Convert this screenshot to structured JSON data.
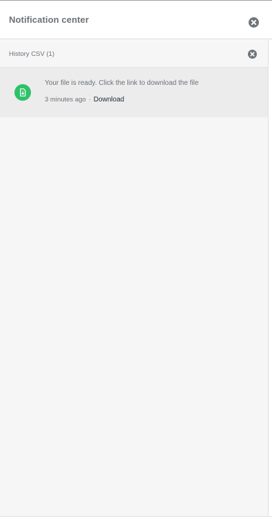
{
  "header": {
    "title": "Notification center"
  },
  "groups": [
    {
      "title": "History CSV (1)",
      "items": [
        {
          "icon": "file-download-icon",
          "message": "Your file is ready. Click the link to download the file",
          "time": "3 minutes ago",
          "separator": "·",
          "link_label": "Download"
        }
      ]
    }
  ],
  "colors": {
    "accent_green": "#2ec16a",
    "close_gray": "#6f757b",
    "panel_bg": "#f6f6f6",
    "item_bg": "#ececec"
  }
}
